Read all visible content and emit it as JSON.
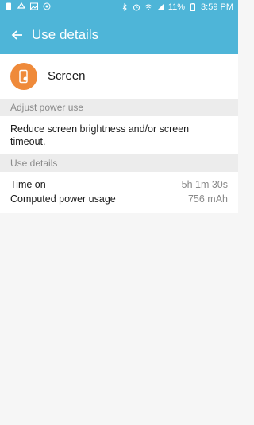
{
  "status": {
    "battery": "11%",
    "time": "3:59 PM"
  },
  "app_bar": {
    "title": "Use details"
  },
  "item": {
    "name": "Screen"
  },
  "sections": {
    "adjust_header": "Adjust power use",
    "adjust_text": "Reduce screen brightness and/or screen timeout.",
    "details_header": "Use details"
  },
  "details": [
    {
      "label": "Time on",
      "value": "5h 1m 30s"
    },
    {
      "label": "Computed power usage",
      "value": "756 mAh"
    }
  ],
  "colors": {
    "accent": "#4eb5d8",
    "icon_bg": "#ef8a3a"
  }
}
